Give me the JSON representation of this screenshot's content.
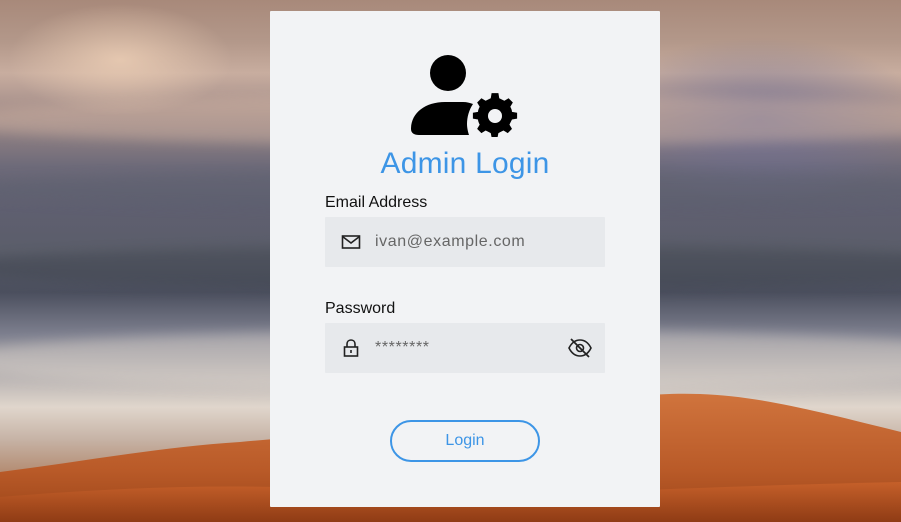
{
  "page": {
    "title": "Admin Login"
  },
  "form": {
    "email": {
      "label": "Email Address",
      "placeholder": "ivan@example.com",
      "value": ""
    },
    "password": {
      "label": "Password",
      "placeholder": "********",
      "value": ""
    },
    "submit_label": "Login"
  },
  "icons": {
    "header": "admin-settings-icon",
    "email": "mail-icon",
    "password": "lock-icon",
    "visibility": "eye-slash-icon"
  },
  "colors": {
    "accent": "#3d95e6",
    "card_background": "#f2f3f5",
    "field_background": "#e7e9ec"
  }
}
